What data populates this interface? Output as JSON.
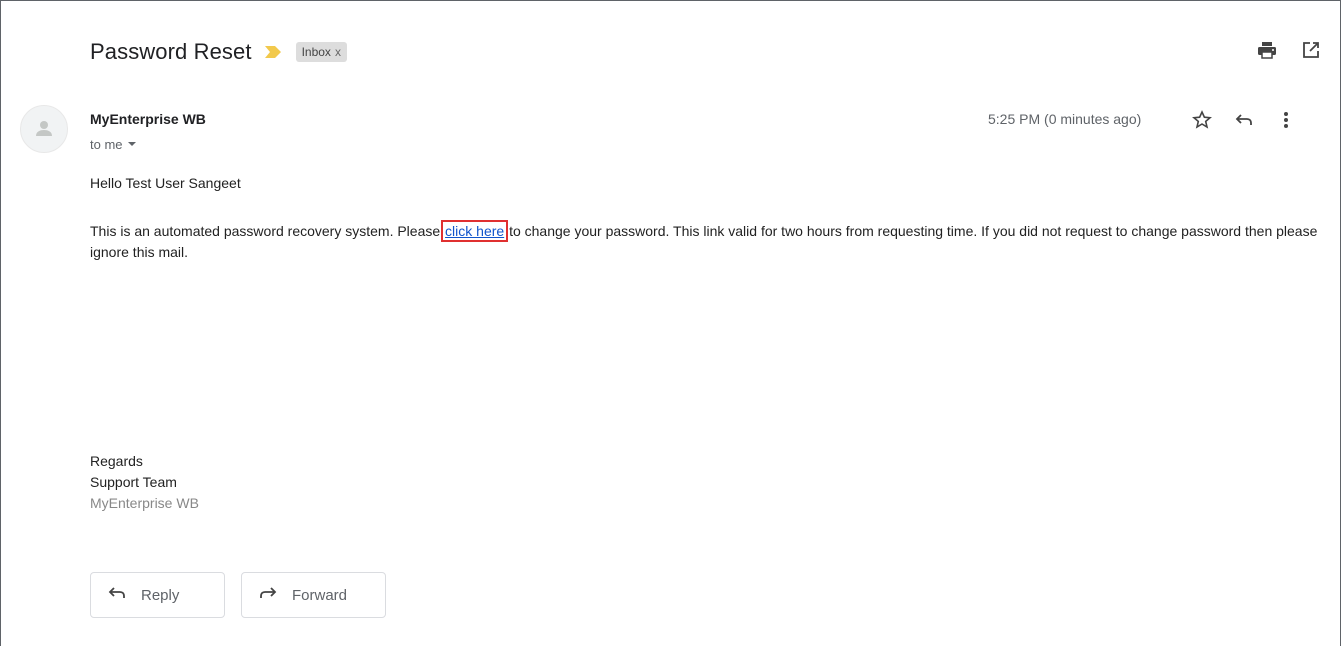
{
  "header": {
    "subject": "Password Reset",
    "label_chip": "Inbox",
    "chip_close": "x",
    "importance_color": "#f2c94c",
    "actions": [
      {
        "name": "print-icon",
        "title": "Print all"
      },
      {
        "name": "open-in-new-window-icon",
        "title": "In new window"
      }
    ]
  },
  "message": {
    "sender_name": "MyEnterprise WB",
    "recipient": "to me",
    "timestamp": "5:25 PM (0 minutes ago)",
    "greeting": "Hello Test User Sangeet",
    "body_before_link": "This is an automated password recovery system. Please",
    "link_text": "click here",
    "body_after_link": "to change your password. This link valid for two hours from requesting time. If you did not request to change password then please ignore this mail.",
    "link_highlight_color": "#e03030",
    "signature": {
      "line1": "Regards",
      "line2": "Support Team",
      "line3": "MyEnterprise WB"
    }
  },
  "buttons": {
    "reply_label": "Reply",
    "forward_label": "Forward"
  }
}
